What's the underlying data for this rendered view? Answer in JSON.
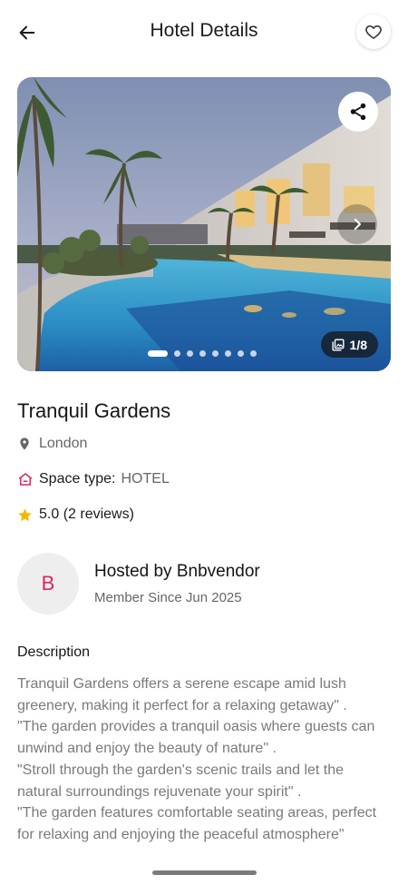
{
  "header": {
    "title": "Hotel Details",
    "back_icon": "arrow-left-icon",
    "favorite_icon": "heart-outline-icon"
  },
  "gallery": {
    "counter": "1/8",
    "total_images": 8,
    "active_index": 1,
    "share_icon": "share-icon",
    "next_icon": "chevron-right-icon",
    "counter_icon": "image-stack-icon"
  },
  "hotel": {
    "name": "Tranquil Gardens",
    "location": "London",
    "location_icon": "map-pin-icon",
    "space_type_label": "Space type:",
    "space_type_value": "HOTEL",
    "space_type_icon": "house-icon",
    "rating": "5.0 (2 reviews)",
    "rating_icon": "star-icon"
  },
  "host": {
    "initial": "B",
    "name": "Hosted by Bnbvendor",
    "member_since": "Member Since Jun 2025"
  },
  "description": {
    "title": "Description",
    "text": "Tranquil Gardens offers a serene escape amid lush greenery, making it perfect for a relaxing getaway\" .\n\"The garden provides a tranquil oasis where guests can unwind and enjoy the beauty of nature\" .\n\"Stroll through the garden's scenic trails and let the natural surroundings rejuvenate your spirit\" .\n\"The garden features comfortable seating areas, perfect for relaxing and enjoying the peaceful atmosphere\""
  },
  "colors": {
    "accent": "#e0245e",
    "star": "#f5b800",
    "text_primary": "#151515",
    "text_secondary": "#666666"
  }
}
